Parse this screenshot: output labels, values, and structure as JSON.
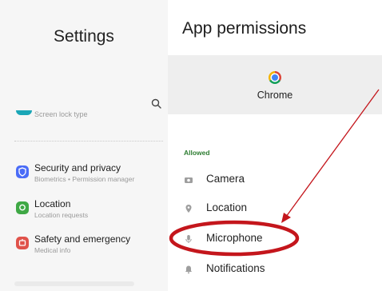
{
  "settings": {
    "title": "Settings",
    "search_icon": "search-icon",
    "partial_item": {
      "subtitle": "Screen lock type",
      "icon_color": "#1aa6b7"
    },
    "items": [
      {
        "title": "Security and privacy",
        "subtitle": "Biometrics  •  Permission manager",
        "icon": "shield-icon",
        "icon_color": "#4a6cf7"
      },
      {
        "title": "Location",
        "subtitle": "Location requests",
        "icon": "location-pin-icon",
        "icon_color": "#3fa845"
      },
      {
        "title": "Safety and emergency",
        "subtitle": "Medical info",
        "icon": "emergency-icon",
        "icon_color": "#e0524a"
      }
    ]
  },
  "app_permissions": {
    "title": "App permissions",
    "app_name": "Chrome",
    "app_icon": "chrome-icon",
    "section_label": "Allowed",
    "permissions": [
      {
        "label": "Camera",
        "icon": "camera-icon"
      },
      {
        "label": "Location",
        "icon": "location-pin-icon"
      },
      {
        "label": "Microphone",
        "icon": "microphone-icon"
      },
      {
        "label": "Notifications",
        "icon": "bell-icon"
      }
    ]
  },
  "annotation": {
    "type": "red arrow and ellipse highlighting Microphone",
    "color": "#c4161c"
  }
}
